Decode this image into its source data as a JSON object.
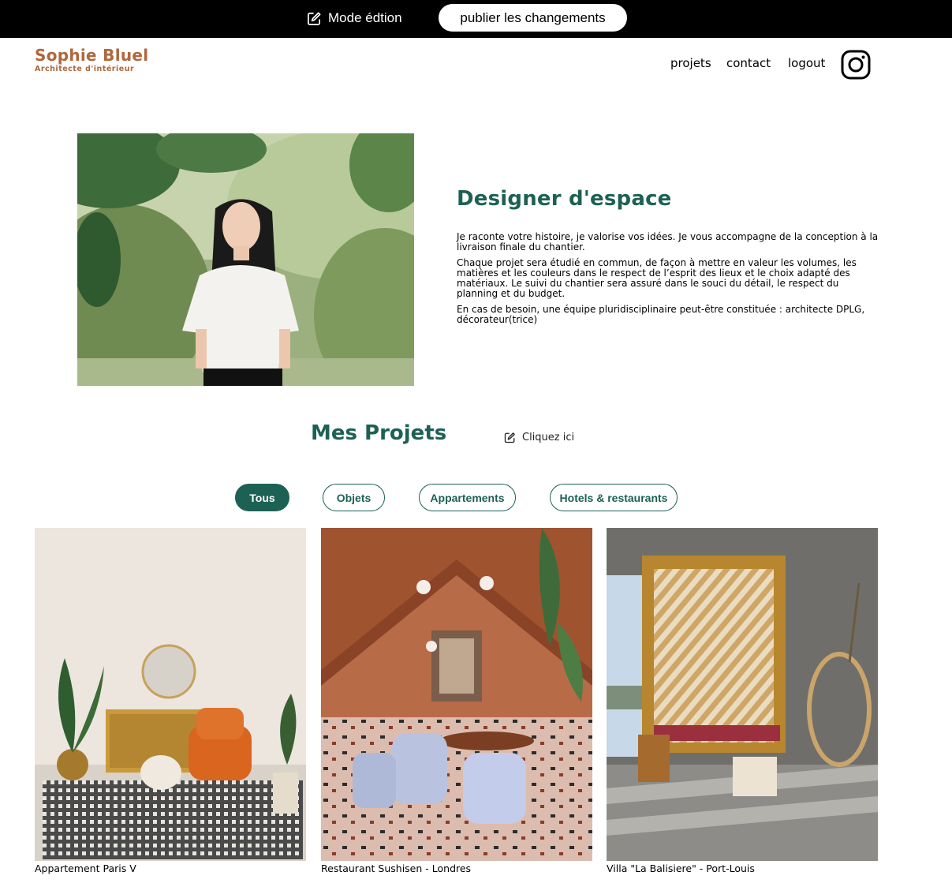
{
  "edit_bar": {
    "mode_label": "Mode édtion",
    "publish_label": "publier les changements"
  },
  "header": {
    "logo_title": "Sophie Bluel",
    "logo_subtitle": "Architecte d'intérieur",
    "nav": {
      "projets": "projets",
      "contact": "contact",
      "logout": "logout"
    },
    "social_icon": "instagram-icon"
  },
  "intro": {
    "title": "Designer d'espace",
    "paragraphs": [
      "Je raconte votre histoire, je valorise vos idées. Je vous accompagne de la conception à la livraison finale du chantier.",
      "Chaque projet sera étudié en commun, de façon à mettre en valeur les volumes, les matières et les couleurs dans le respect de l’esprit des lieux et le choix adapté des matériaux. Le suivi du chantier sera assuré dans le souci du détail, le respect du planning et du budget.",
      "En cas de besoin, une équipe pluridisciplinaire peut-être constituée : architecte DPLG, décorateur(trice)"
    ]
  },
  "projects": {
    "title": "Mes Projets",
    "edit_label": "Cliquez ici",
    "filters": [
      "Tous",
      "Objets",
      "Appartements",
      "Hotels & restaurants"
    ],
    "active_filter": "Tous",
    "items": [
      {
        "caption": "Appartement Paris V"
      },
      {
        "caption": "Restaurant Sushisen - Londres"
      },
      {
        "caption": "Villa \"La Balisiere\" - Port-Louis"
      }
    ]
  },
  "colors": {
    "brand": "#b1663c",
    "accent": "#1d6154",
    "bar": "#000000"
  }
}
